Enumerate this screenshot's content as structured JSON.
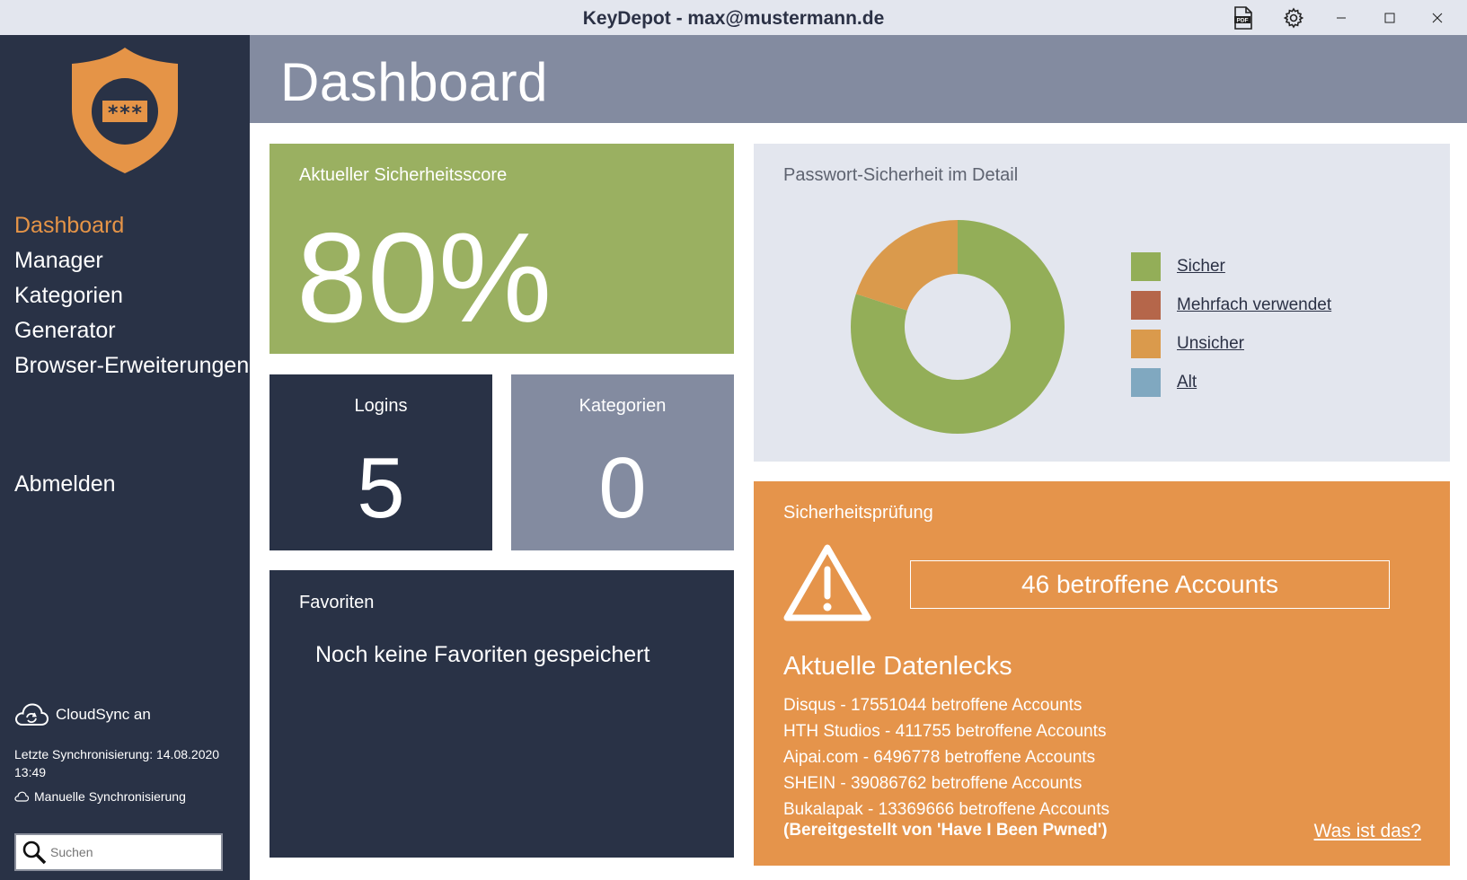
{
  "window": {
    "title": "KeyDepot - max@mustermann.de",
    "icons": [
      "pdf-icon",
      "gear-icon",
      "minimize-icon",
      "maximize-icon",
      "close-icon"
    ],
    "pdf_glyph": "PDF"
  },
  "sidebar": {
    "logo_text": "***",
    "items": [
      {
        "label": "Dashboard",
        "active": true
      },
      {
        "label": "Manager",
        "active": false
      },
      {
        "label": "Kategorien",
        "active": false
      },
      {
        "label": "Generator",
        "active": false
      },
      {
        "label": "Browser-Erweiterungen",
        "active": false
      }
    ],
    "logout": "Abmelden",
    "cloud_status": "CloudSync an",
    "last_sync": "Letzte Synchronisierung: 14.08.2020 13:49",
    "manual_sync": "Manuelle Synchronisierung",
    "search_placeholder": "Suchen"
  },
  "header": {
    "title": "Dashboard"
  },
  "score": {
    "label": "Aktueller Sicherheitsscore",
    "value": "80%"
  },
  "logins": {
    "label": "Logins",
    "value": "5"
  },
  "categories": {
    "label": "Kategorien",
    "value": "0"
  },
  "favorites": {
    "label": "Favoriten",
    "empty": "Noch keine Favoriten gespeichert"
  },
  "detail": {
    "label": "Passwort-Sicherheit im Detail",
    "legend": [
      {
        "label": "Sicher",
        "color": "#93ae58"
      },
      {
        "label": "Mehrfach verwendet",
        "color": "#b5664a"
      },
      {
        "label": "Unsicher",
        "color": "#da9a4c"
      },
      {
        "label": "Alt",
        "color": "#80a8c0"
      }
    ]
  },
  "chart_data": {
    "type": "pie",
    "categories": [
      "Sicher",
      "Mehrfach verwendet",
      "Unsicher",
      "Alt"
    ],
    "values": [
      80,
      0,
      20,
      0
    ],
    "legend": "right"
  },
  "security_check": {
    "label": "Sicherheitsprüfung",
    "affected": "46 betroffene Accounts",
    "leaks_heading": "Aktuelle Datenlecks",
    "leaks": [
      "Disqus - 17551044 betroffene Accounts",
      "HTH Studios - 411755 betroffene Accounts",
      "Aipai.com - 6496778 betroffene Accounts",
      "SHEIN - 39086762 betroffene Accounts",
      "Bukalapak - 13369666 betroffene Accounts"
    ],
    "credit": "(Bereitgestellt von 'Have I Been Pwned')",
    "what_is_this": "Was ist das?"
  },
  "colors": {
    "sidebar": "#293246",
    "accent": "#e59447",
    "score_green": "#9ab061",
    "header_gray": "#838ba0",
    "check_orange": "#e5944b"
  }
}
